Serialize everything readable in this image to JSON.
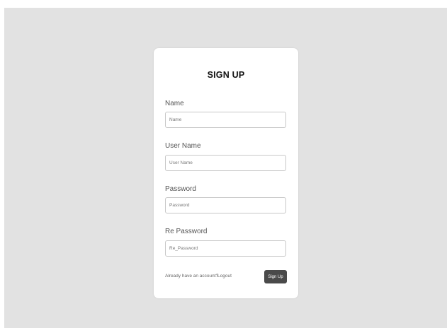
{
  "form": {
    "title": "SIGN UP",
    "fields": [
      {
        "label": "Name",
        "placeholder": "Name"
      },
      {
        "label": "User Name",
        "placeholder": "User Name"
      },
      {
        "label": "Password",
        "placeholder": "Password"
      },
      {
        "label": "Re Password",
        "placeholder": "Re_Password"
      }
    ],
    "footer_text": "Already have an account?",
    "logout_link": "Logout",
    "submit_label": "Sign Up"
  },
  "colors": {
    "page_background": "#e2e2e2",
    "card_background": "#ffffff",
    "button_background": "#4a4a4a",
    "input_border": "#c7c7c7"
  }
}
